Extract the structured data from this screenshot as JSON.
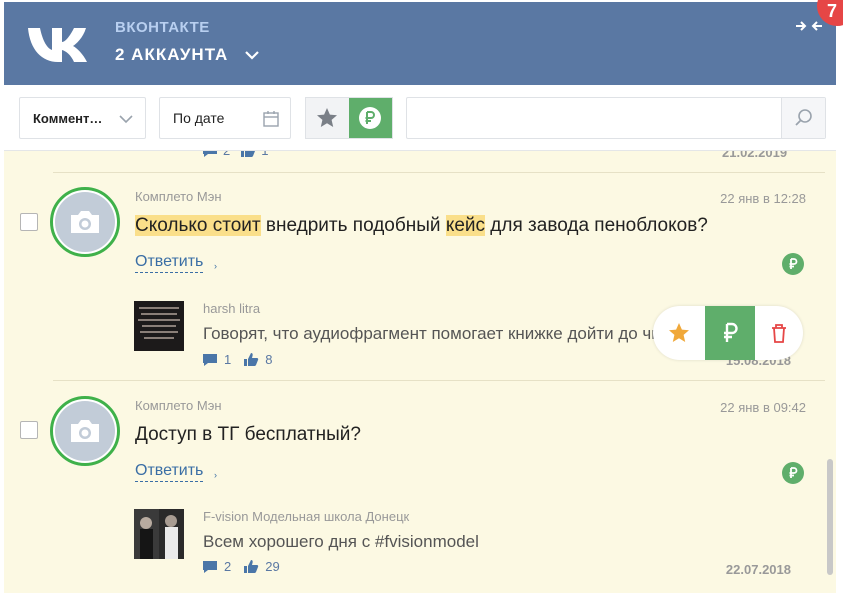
{
  "header": {
    "brand": "ВКОНТАКТЕ",
    "accounts_label": "2 АККАУНТА",
    "badge_count": "7",
    "colors": {
      "bar": "#5a78a3",
      "brand": "#b8cff0",
      "badge": "#e64646"
    }
  },
  "toolbar": {
    "type_select": "Коммент…",
    "date_select": "По дате",
    "search": {
      "value": "",
      "placeholder": ""
    },
    "rub_color": "#5fae6b"
  },
  "partial_item": {
    "comments": "2",
    "likes": "1",
    "date": "21.02.2019"
  },
  "comments": [
    {
      "author": "Комплето Мэн",
      "time": "22 янв в 12:28",
      "text_parts": [
        "Сколько стоит",
        " внедрить подобный ",
        "кейс",
        " для завода пеноблоков?"
      ],
      "reply_label": "Ответить",
      "post": {
        "author": "harsh litra",
        "text": "Говорят, что аудиофрагмент помогает книжке дойти до читателя",
        "comments": "1",
        "likes": "8",
        "date": "15.08.2018"
      }
    },
    {
      "author": "Комплето Мэн",
      "time": "22 янв в 09:42",
      "text": "Доступ в ТГ бесплатный?",
      "reply_label": "Ответить",
      "post": {
        "author": "F-vision Модельная школа Донецк",
        "text": "Всем хорошего дня с #fvisionmodel",
        "comments": "2",
        "likes": "29",
        "date": "22.07.2018"
      }
    }
  ],
  "icons": [
    "vk-logo-icon",
    "chevron-down-icon",
    "collapse-arrows-icon",
    "calendar-icon",
    "star-icon",
    "ruble-icon",
    "search-icon",
    "camera-icon",
    "comment-icon",
    "like-icon",
    "trash-icon"
  ],
  "colors": {
    "feed_bg": "#fcf9e3",
    "highlight": "#fadf8a",
    "link": "#3a6ea5",
    "avatar_ring": "#3fb14a"
  }
}
